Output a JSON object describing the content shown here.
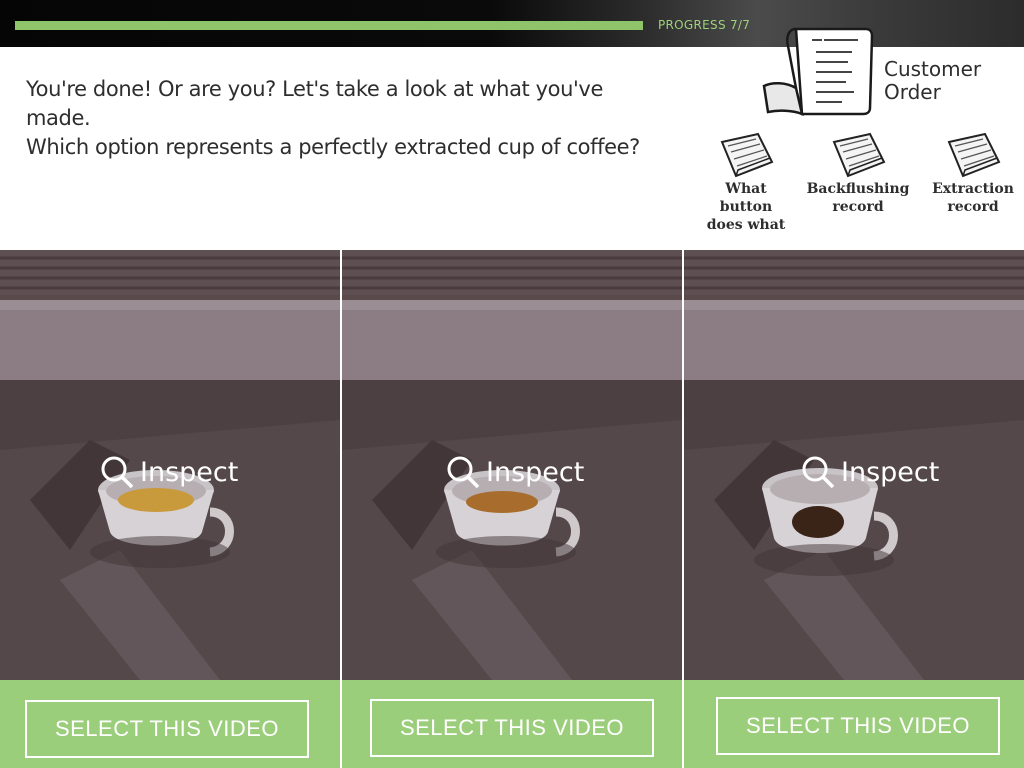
{
  "progress": {
    "label": "PROGRESS 7/7",
    "current": 7,
    "total": 7,
    "fraction": 1.0
  },
  "question": {
    "line1": "You're done! Or are you? Let's take a look at what you've made.",
    "line2": "Which option represents a perfectly extracted cup of coffee?"
  },
  "customer_order": {
    "line1": "Customer",
    "line2": "Order",
    "icon": "receipt-icon"
  },
  "documents": [
    {
      "label_lines": [
        "What",
        "button",
        "does what"
      ],
      "icon": "document-icon"
    },
    {
      "label_lines": [
        "Backflushing",
        "record"
      ],
      "icon": "document-icon"
    },
    {
      "label_lines": [
        "Extraction",
        "record"
      ],
      "icon": "document-icon"
    }
  ],
  "videos": [
    {
      "inspect_label": "Inspect",
      "select_label": "SELECT THIS VIDEO",
      "coffee_color": "#c99a3c"
    },
    {
      "inspect_label": "Inspect",
      "select_label": "SELECT THIS VIDEO",
      "coffee_color": "#a86d2c"
    },
    {
      "inspect_label": "Inspect",
      "select_label": "SELECT THIS VIDEO",
      "coffee_color": "#3a2418"
    }
  ],
  "colors": {
    "accent_green": "#9bce7b",
    "progress_green": "#8fc46a",
    "text": "#2e2e2e"
  }
}
